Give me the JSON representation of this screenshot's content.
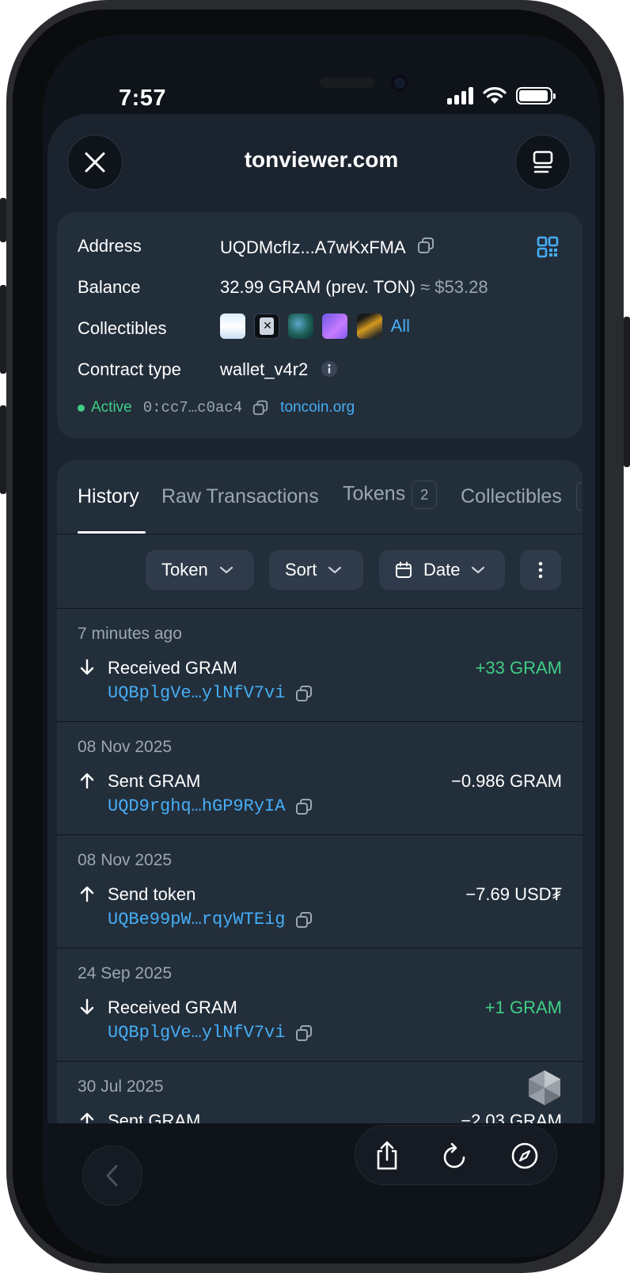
{
  "status": {
    "time": "7:57"
  },
  "browser": {
    "url_title": "tonviewer.com"
  },
  "account": {
    "address_label": "Address",
    "address_value": "UQDMcfIz...A7wKxFMA",
    "balance_label": "Balance",
    "balance_value": "32.99 GRAM (prev. TON)",
    "balance_fiat": "≈ $53.28",
    "collectibles_label": "Collectibles",
    "collectibles_all": "All",
    "contract_label": "Contract type",
    "contract_value": "wallet_v4r2",
    "state": "Active",
    "code_hash": "0:cc7…c0ac4",
    "source_link": "toncoin.org"
  },
  "tabs": [
    {
      "label": "History",
      "badge": ""
    },
    {
      "label": "Raw Transactions",
      "badge": ""
    },
    {
      "label": "Tokens",
      "badge": "2"
    },
    {
      "label": "Collectibles",
      "badge": ""
    }
  ],
  "filters": {
    "token": "Token",
    "sort": "Sort",
    "date": "Date"
  },
  "transactions": [
    {
      "date": "7 minutes ago",
      "direction": "in",
      "title": "Received GRAM",
      "address": "UQBplgVe…ylNfV7vi",
      "amount": "+33 GRAM",
      "positive": true
    },
    {
      "date": "08 Nov 2025",
      "direction": "out",
      "title": "Sent GRAM",
      "address": "UQD9rghq…hGP9RyIA",
      "amount": "−0.986 GRAM",
      "positive": false
    },
    {
      "date": "08 Nov 2025",
      "direction": "out",
      "title": "Send token",
      "address": "UQBe99pW…rqyWTEig",
      "amount": "−7.69 USD₮",
      "positive": false
    },
    {
      "date": "24 Sep 2025",
      "direction": "in",
      "title": "Received GRAM",
      "address": "UQBplgVe…ylNfV7vi",
      "amount": "+1 GRAM",
      "positive": true
    },
    {
      "date": "30 Jul 2025",
      "direction": "out",
      "title": "Sent GRAM",
      "address": "",
      "amount": "−2.03 GRAM",
      "positive": false
    }
  ],
  "colors": {
    "positive": "#3fcf85",
    "link": "#45aef5",
    "background": "#1b232e",
    "card": "#232e3b"
  },
  "icons": [
    "close-icon",
    "menu-icon",
    "copy-icon",
    "qr-code-icon",
    "info-icon",
    "calendar-icon",
    "chevron-down-icon",
    "more-vertical-icon",
    "arrow-down-icon",
    "arrow-up-icon",
    "chevron-left-icon",
    "share-icon",
    "reload-icon",
    "compass-icon",
    "gem-icon"
  ]
}
